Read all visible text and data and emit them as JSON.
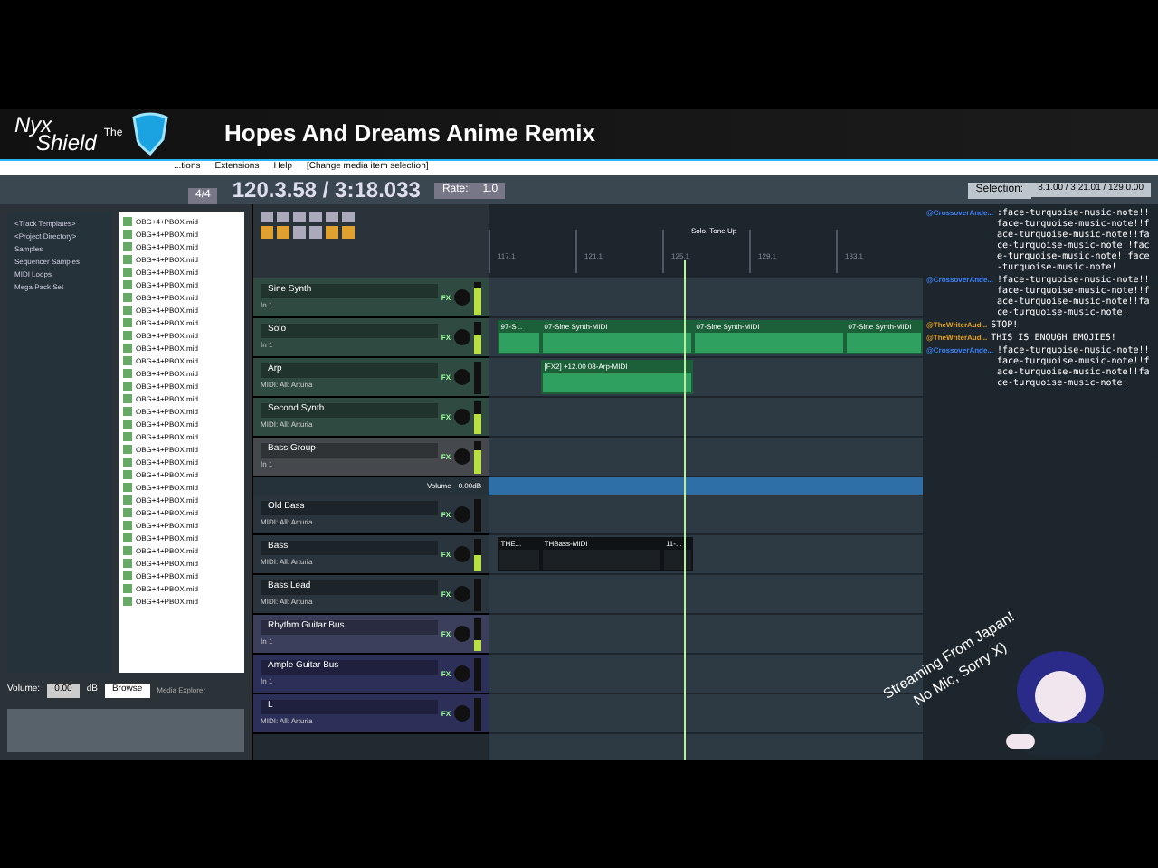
{
  "overlay": {
    "logo": {
      "line1": "Nyx",
      "line2": "Shield",
      "small": "The"
    },
    "title": "Hopes And Dreams Anime Remix",
    "caption_lines": [
      "Streaming From Japan!",
      "No Mic, Sorry X)"
    ]
  },
  "menu": {
    "items": [
      "...tions",
      "Extensions",
      "Help",
      "[Change media item selection]"
    ]
  },
  "transport": {
    "buttons": [
      "4/4"
    ],
    "position": "120.3.58 / 3:18.033",
    "rate_label": "Rate:",
    "rate": "1.0",
    "selection_label": "Selection:",
    "selection": "8.1.00 / 3:21.01 / 129.0.00"
  },
  "browser": {
    "tree": [
      "<Track Templates>",
      "<Project Directory>",
      "Samples",
      "Sequencer Samples",
      "MIDI Loops",
      "Mega Pack Set"
    ],
    "files": [
      "OBG+4+PBOX.mid",
      "OBG+4+PBOX.mid",
      "OBG+4+PBOX.mid",
      "OBG+4+PBOX.mid",
      "OBG+4+PBOX.mid",
      "OBG+4+PBOX.mid",
      "OBG+4+PBOX.mid",
      "OBG+4+PBOX.mid",
      "OBG+4+PBOX.mid",
      "OBG+4+PBOX.mid",
      "OBG+4+PBOX.mid",
      "OBG+4+PBOX.mid",
      "OBG+4+PBOX.mid",
      "OBG+4+PBOX.mid",
      "OBG+4+PBOX.mid",
      "OBG+4+PBOX.mid",
      "OBG+4+PBOX.mid",
      "OBG+4+PBOX.mid",
      "OBG+4+PBOX.mid",
      "OBG+4+PBOX.mid",
      "OBG+4+PBOX.mid",
      "OBG+4+PBOX.mid",
      "OBG+4+PBOX.mid",
      "OBG+4+PBOX.mid",
      "OBG+4+PBOX.mid",
      "OBG+4+PBOX.mid",
      "OBG+4+PBOX.mid",
      "OBG+4+PBOX.mid",
      "OBG+4+PBOX.mid",
      "OBG+4+PBOX.mid",
      "OBG+4+PBOX.mid"
    ],
    "volume_label": "Volume:",
    "volume": "0.00",
    "unit": "dB",
    "browse": "Browse",
    "side_label": "Media Explorer"
  },
  "tracks": [
    {
      "name": "Sine Synth",
      "fx": "FX",
      "input": "In 1",
      "color": "#2f4a40",
      "level": 0.8
    },
    {
      "name": "Solo",
      "fx": "FX",
      "input": "In 1",
      "color": "#2f4a40",
      "level": 0.6,
      "clips": [
        {
          "label": "97-S...",
          "kind": "midi"
        },
        {
          "label": "07-Sine Synth-MIDI",
          "kind": "midi"
        },
        {
          "label": "07-Sine Synth-MIDI",
          "kind": "midi"
        },
        {
          "label": "07-Sine Synth-MIDI",
          "kind": "midi"
        }
      ]
    },
    {
      "name": "Arp",
      "fx": "FX",
      "input": "MIDI: All: Arturia",
      "color": "#2f4a40",
      "level": 0.0,
      "clips": [
        {
          "label": "[FX2] +12.00 08-Arp-MIDI",
          "kind": "midi"
        }
      ]
    },
    {
      "name": "Second Synth",
      "fx": "FX",
      "input": "MIDI: All: Arturia",
      "color": "#2f4a40",
      "level": 0.6
    },
    {
      "name": "Bass Group",
      "fx": "FX",
      "input": "In 1",
      "color": "#45494e",
      "level": 0.7
    },
    {
      "name": "Old Bass",
      "fx": "FX",
      "input": "MIDI: All: Arturia",
      "color": "#2a343c",
      "level": 0.0
    },
    {
      "name": "Bass",
      "fx": "FX",
      "input": "MIDI: All: Arturia",
      "color": "#2a343c",
      "level": 0.5,
      "clips": [
        {
          "label": "THE...",
          "kind": "dark"
        },
        {
          "label": "THBass-MIDI",
          "kind": "dark"
        },
        {
          "label": "11-...",
          "kind": "dark"
        }
      ]
    },
    {
      "name": "Bass Lead",
      "fx": "FX",
      "input": "MIDI: All: Arturia",
      "color": "#2a343c",
      "level": 0.0
    },
    {
      "name": "Rhythm Guitar Bus",
      "fx": "FX",
      "input": "In 1",
      "color": "#3c3f5c",
      "level": 0.3
    },
    {
      "name": "Ample Guitar Bus",
      "fx": "FX",
      "input": "In 1",
      "color": "#2c2f58",
      "level": 0.0
    },
    {
      "name": "L",
      "fx": "FX",
      "input": "MIDI: All: Arturia",
      "color": "#2c2f58",
      "level": 0.0
    }
  ],
  "envelope": {
    "label": "Volume",
    "value": "0.00dB"
  },
  "ruler": {
    "ticks": [
      "117.1",
      "121.1",
      "125.1",
      "129.1",
      "133.1"
    ],
    "marker": "Solo, Tone Up"
  },
  "chat": [
    {
      "user": "@CrossoverAnde...",
      "color": "#3b82f6",
      "text": ":face-turquoise-music-note!!face-turquoise-music-note!!face-turquoise-music-note!!face-turquoise-music-note!!face-turquoise-music-note!!face-turquoise-music-note!"
    },
    {
      "user": "@CrossoverAnde...",
      "color": "#3b82f6",
      "text": "!face-turquoise-music-note!!face-turquoise-music-note!!face-turquoise-music-note!!face-turquoise-music-note!"
    },
    {
      "user": "@TheWriterAud...",
      "color": "#e0a020",
      "text": "STOP!"
    },
    {
      "user": "@TheWriterAud...",
      "color": "#e0a020",
      "text": "THIS IS ENOUGH EMOJIES!"
    },
    {
      "user": "@CrossoverAnde...",
      "color": "#3b82f6",
      "text": "!face-turquoise-music-note!!face-turquoise-music-note!!face-turquoise-music-note!!face-turquoise-music-note!"
    }
  ]
}
